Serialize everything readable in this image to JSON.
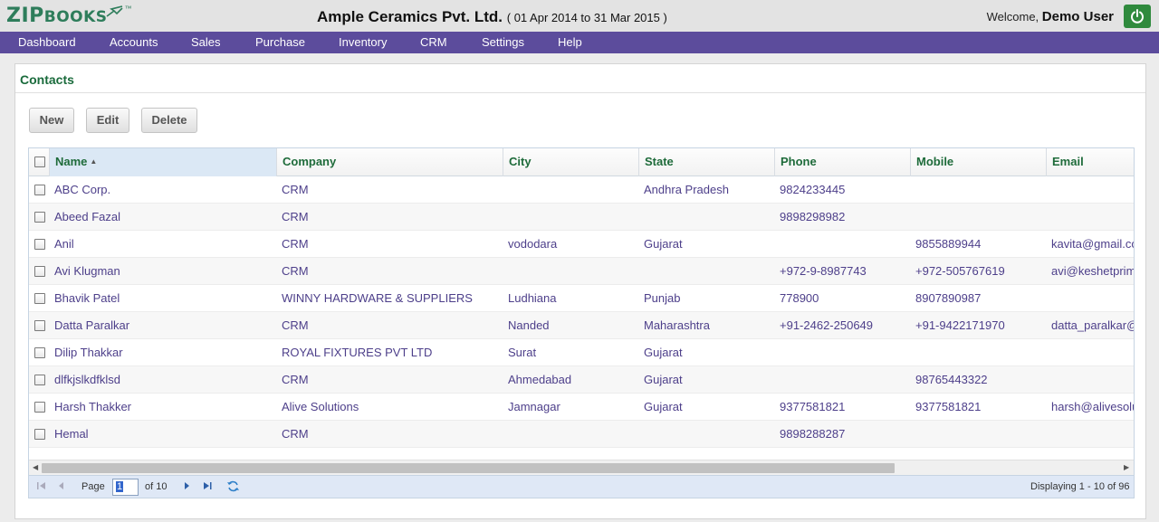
{
  "app": {
    "logo_main": "ZIP",
    "logo_small": "BOOKS",
    "logo_tm": "™",
    "company_name": "Ample Ceramics Pvt. Ltd.",
    "period": "( 01 Apr 2014 to 31 Mar 2015 )",
    "welcome_label": "Welcome,",
    "user_name": "Demo User",
    "brand_color": "#2e7d5b",
    "nav_color": "#5c4c9c"
  },
  "nav": {
    "items": [
      "Dashboard",
      "Accounts",
      "Sales",
      "Purchase",
      "Inventory",
      "CRM",
      "Settings",
      "Help"
    ]
  },
  "panel": {
    "title": "Contacts"
  },
  "toolbar": {
    "new_label": "New",
    "edit_label": "Edit",
    "delete_label": "Delete"
  },
  "grid": {
    "columns": [
      "Name",
      "Company",
      "City",
      "State",
      "Phone",
      "Mobile",
      "Email"
    ],
    "sorted_column": "Name",
    "sort_direction": "asc",
    "rows": [
      {
        "name": "ABC Corp.",
        "company": "CRM",
        "city": "",
        "state": "Andhra Pradesh",
        "phone": "9824233445",
        "mobile": "",
        "email": ""
      },
      {
        "name": "Abeed Fazal",
        "company": "CRM",
        "city": "",
        "state": "",
        "phone": "9898298982",
        "mobile": "",
        "email": ""
      },
      {
        "name": "Anil",
        "company": "CRM",
        "city": "vododara",
        "state": "Gujarat",
        "phone": "",
        "mobile": "9855889944",
        "email": "kavita@gmail.co"
      },
      {
        "name": "Avi Klugman",
        "company": "CRM",
        "city": "",
        "state": "",
        "phone": "+972-9-8987743",
        "mobile": "+972-505767619",
        "email": "avi@keshetprim"
      },
      {
        "name": "Bhavik Patel",
        "company": "WINNY HARDWARE & SUPPLIERS",
        "city": "Ludhiana",
        "state": "Punjab",
        "phone": "778900",
        "mobile": "8907890987",
        "email": ""
      },
      {
        "name": "Datta Paralkar",
        "company": "CRM",
        "city": "Nanded",
        "state": "Maharashtra",
        "phone": "+91-2462-250649",
        "mobile": "+91-9422171970",
        "email": "datta_paralkar@"
      },
      {
        "name": "Dilip Thakkar",
        "company": "ROYAL FIXTURES PVT LTD",
        "city": "Surat",
        "state": "Gujarat",
        "phone": "",
        "mobile": "",
        "email": ""
      },
      {
        "name": "dlfkjslkdfklsd",
        "company": "CRM",
        "city": "Ahmedabad",
        "state": "Gujarat",
        "phone": "",
        "mobile": "98765443322",
        "email": ""
      },
      {
        "name": "Harsh Thakker",
        "company": "Alive Solutions",
        "city": "Jamnagar",
        "state": "Gujarat",
        "phone": "9377581821",
        "mobile": "9377581821",
        "email": "harsh@alivesolu"
      },
      {
        "name": "Hemal",
        "company": "CRM",
        "city": "",
        "state": "",
        "phone": "9898288287",
        "mobile": "",
        "email": ""
      }
    ]
  },
  "pager": {
    "page_label": "Page",
    "current_page": "1",
    "of_label": "of 10",
    "display_info": "Displaying 1 - 10 of 96"
  }
}
